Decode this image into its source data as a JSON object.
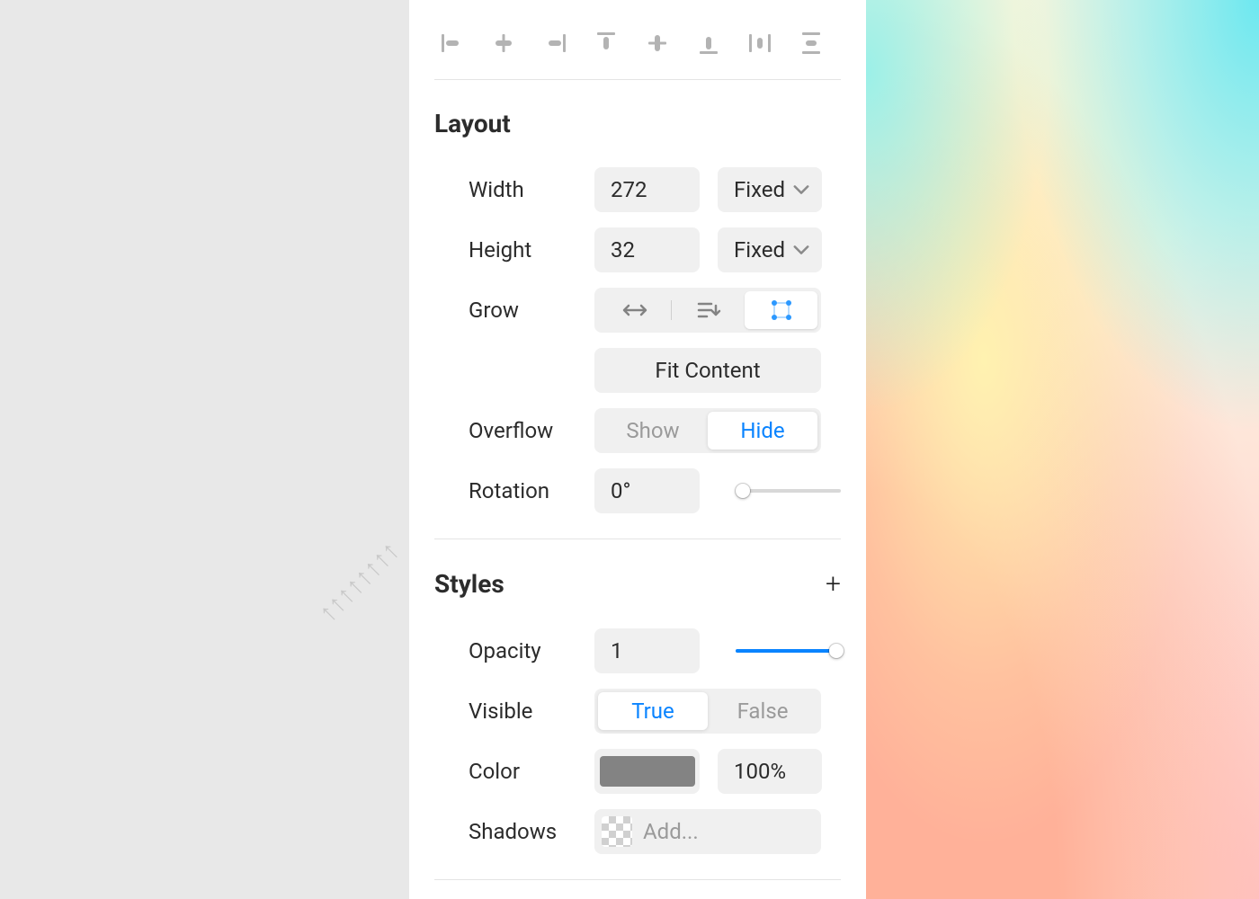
{
  "ghost_text": "↑↑↑↑↑↑↑↑",
  "layout": {
    "title": "Layout",
    "width": {
      "label": "Width",
      "value": "272",
      "mode": "Fixed"
    },
    "height": {
      "label": "Height",
      "value": "32",
      "mode": "Fixed"
    },
    "grow": {
      "label": "Grow",
      "fit_content": "Fit Content"
    },
    "overflow": {
      "label": "Overflow",
      "show": "Show",
      "hide": "Hide"
    },
    "rotation": {
      "label": "Rotation",
      "value": "0°"
    }
  },
  "styles": {
    "title": "Styles",
    "opacity": {
      "label": "Opacity",
      "value": "1"
    },
    "visible": {
      "label": "Visible",
      "true": "True",
      "false": "False"
    },
    "color": {
      "label": "Color",
      "swatch": "#838383",
      "alpha": "100%"
    },
    "shadows": {
      "label": "Shadows",
      "placeholder": "Add..."
    }
  }
}
